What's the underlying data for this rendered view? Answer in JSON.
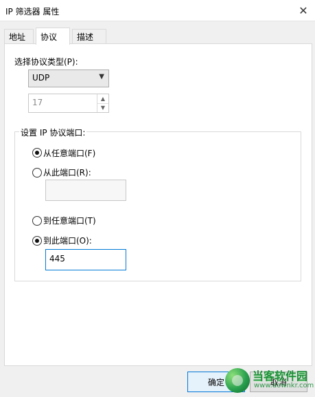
{
  "window": {
    "title": "IP 筛选器 属性",
    "close_icon": "✕"
  },
  "tabs": [
    {
      "label": "地址",
      "selected": false
    },
    {
      "label": "协议",
      "selected": true
    },
    {
      "label": "描述",
      "selected": false
    }
  ],
  "protocol": {
    "label": "选择协议类型(P):",
    "selected": "UDP",
    "number": "17"
  },
  "ports": {
    "group_label": "设置 IP 协议端口:",
    "from_any": {
      "label": "从任意端口(F)",
      "checked": true
    },
    "from_this": {
      "label": "从此端口(R):",
      "checked": false,
      "value": ""
    },
    "to_any": {
      "label": "到任意端口(T)",
      "checked": false
    },
    "to_this": {
      "label": "到此端口(O):",
      "checked": true,
      "value": "445"
    }
  },
  "buttons": {
    "ok": "确定",
    "cancel": "取消"
  },
  "watermark": {
    "title": "当客软件园",
    "url": "www.downkr.com"
  }
}
